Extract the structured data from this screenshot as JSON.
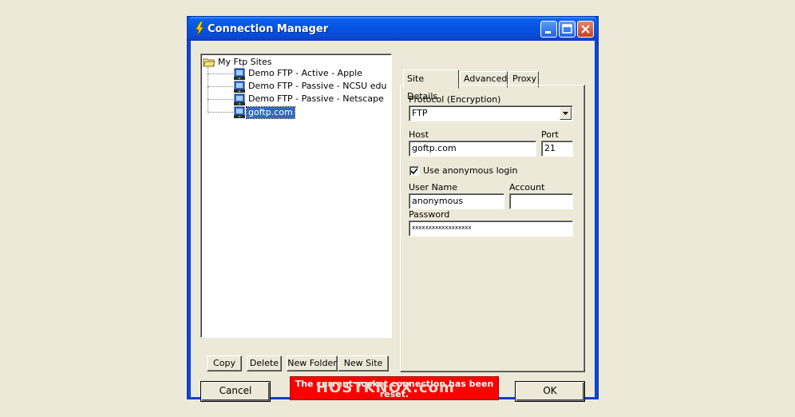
{
  "window": {
    "title": "Connection Manager"
  },
  "tree": {
    "root_label": "My Ftp Sites",
    "items": [
      {
        "label": "Demo FTP - Active - Apple",
        "selected": false
      },
      {
        "label": "Demo FTP - Passive - NCSU edu",
        "selected": false
      },
      {
        "label": "Demo FTP - Passive - Netscape",
        "selected": false
      },
      {
        "label": "goftp.com",
        "selected": true
      }
    ]
  },
  "tree_buttons": {
    "copy": "Copy",
    "delete": "Delete",
    "new_folder": "New Folder",
    "new_site": "New Site"
  },
  "tabs": [
    {
      "label": "Site Details",
      "active": true
    },
    {
      "label": "Advanced",
      "active": false
    },
    {
      "label": "Proxy",
      "active": false
    }
  ],
  "site_details": {
    "protocol_label": "Protocol (Encryption)",
    "protocol_value": "FTP",
    "host_label": "Host",
    "host_value": "goftp.com",
    "port_label": "Port",
    "port_value": "21",
    "anonymous_label": "Use anonymous login",
    "anonymous_checked": true,
    "username_label": "User Name",
    "username_value": "anonymous",
    "account_label": "Account",
    "account_value": "",
    "password_label": "Password",
    "password_value": "xxxxxxxxxxxxxxxxxx"
  },
  "footer": {
    "cancel": "Cancel",
    "ok": "OK",
    "status_message": "The current socket connection has been reset."
  },
  "watermark": "HOSTKNOX.com",
  "colors": {
    "title_blue": "#0a5fe8",
    "status_red": "#ff0000",
    "selection": "#316ac5",
    "dialog_bg": "#ece9d8"
  },
  "icons": {
    "app": "lightning-bolt-icon",
    "folder": "folder-open-icon",
    "site": "ftp-site-icon"
  }
}
